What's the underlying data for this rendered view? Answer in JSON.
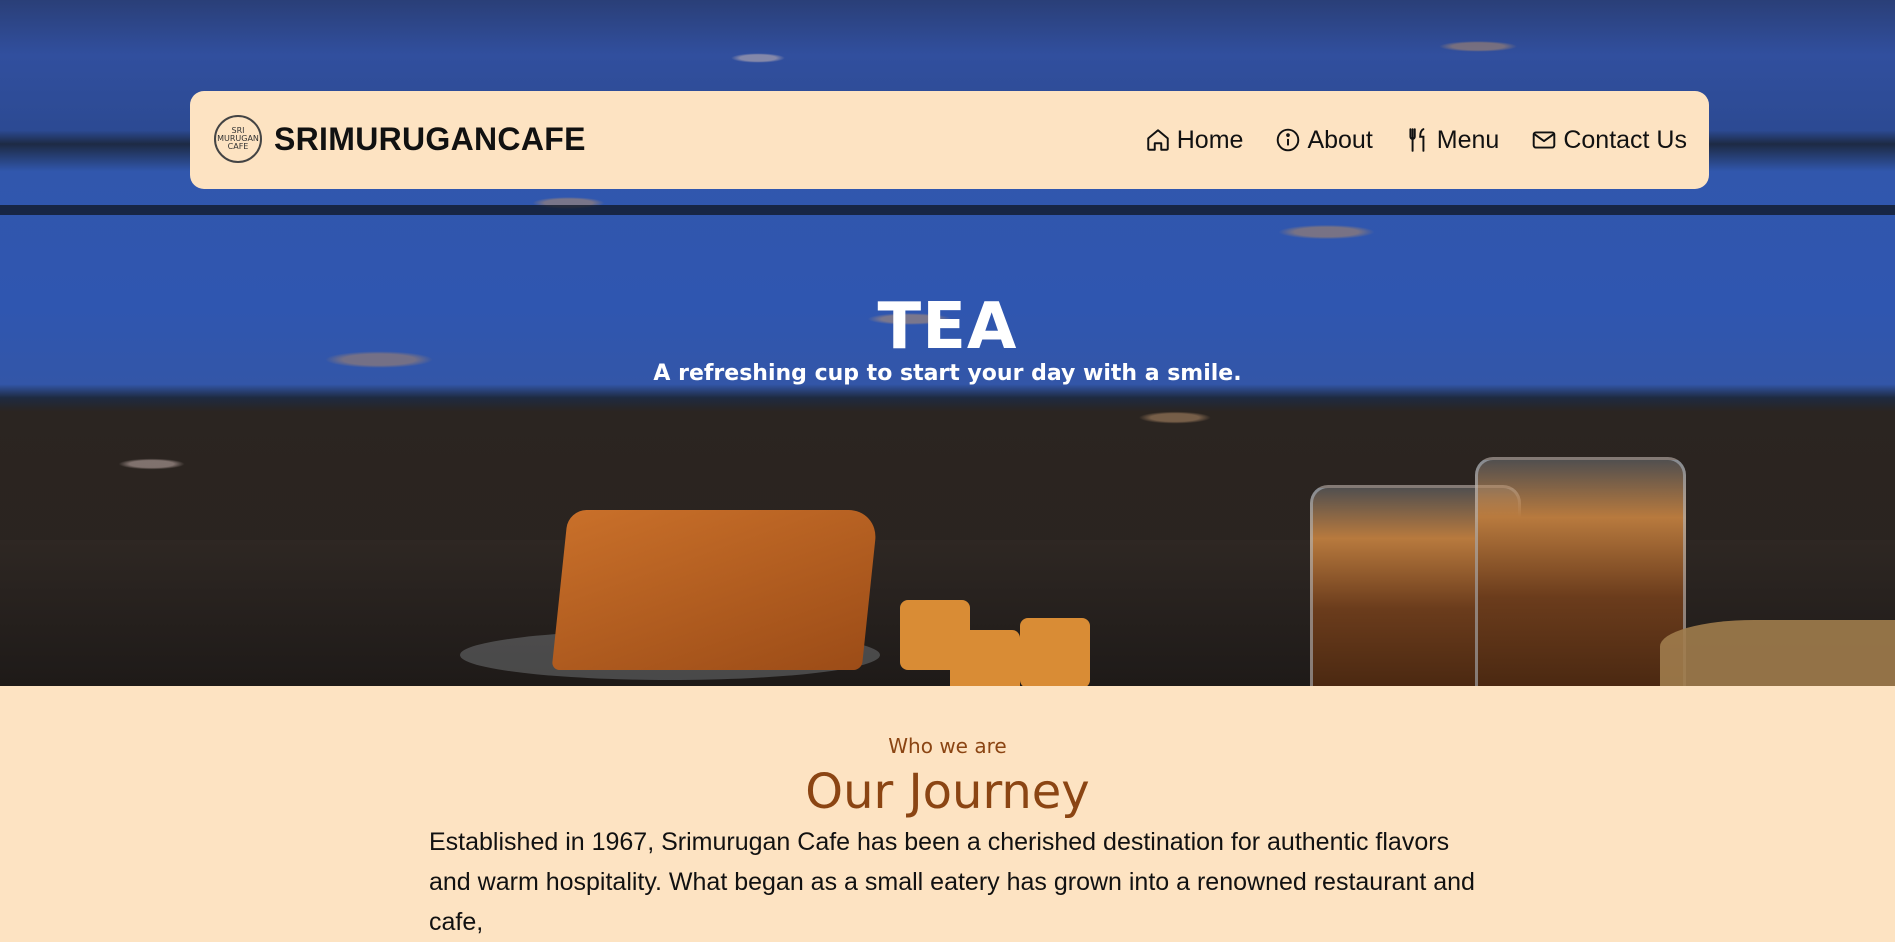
{
  "brand": {
    "name": "SRIMURUGANCAFE",
    "logo_text": "SRI MURUGAN CAFE"
  },
  "nav": {
    "items": [
      {
        "label": "Home",
        "icon": "home-icon"
      },
      {
        "label": "About",
        "icon": "info-icon"
      },
      {
        "label": "Menu",
        "icon": "utensils-icon"
      },
      {
        "label": "Contact Us",
        "icon": "mail-icon"
      }
    ]
  },
  "hero": {
    "title": "TEA",
    "subtitle": "A refreshing cup to start your day with a smile."
  },
  "about": {
    "eyebrow": "Who we are",
    "title": "Our Journey",
    "text": "Established in 1967, Srimurugan Cafe has been a cherished destination for authentic flavors and warm hospitality. What began as a small eatery has grown into a renowned restaurant and cafe,"
  },
  "colors": {
    "cream": "#fde3c2",
    "brown": "#8b4513"
  }
}
